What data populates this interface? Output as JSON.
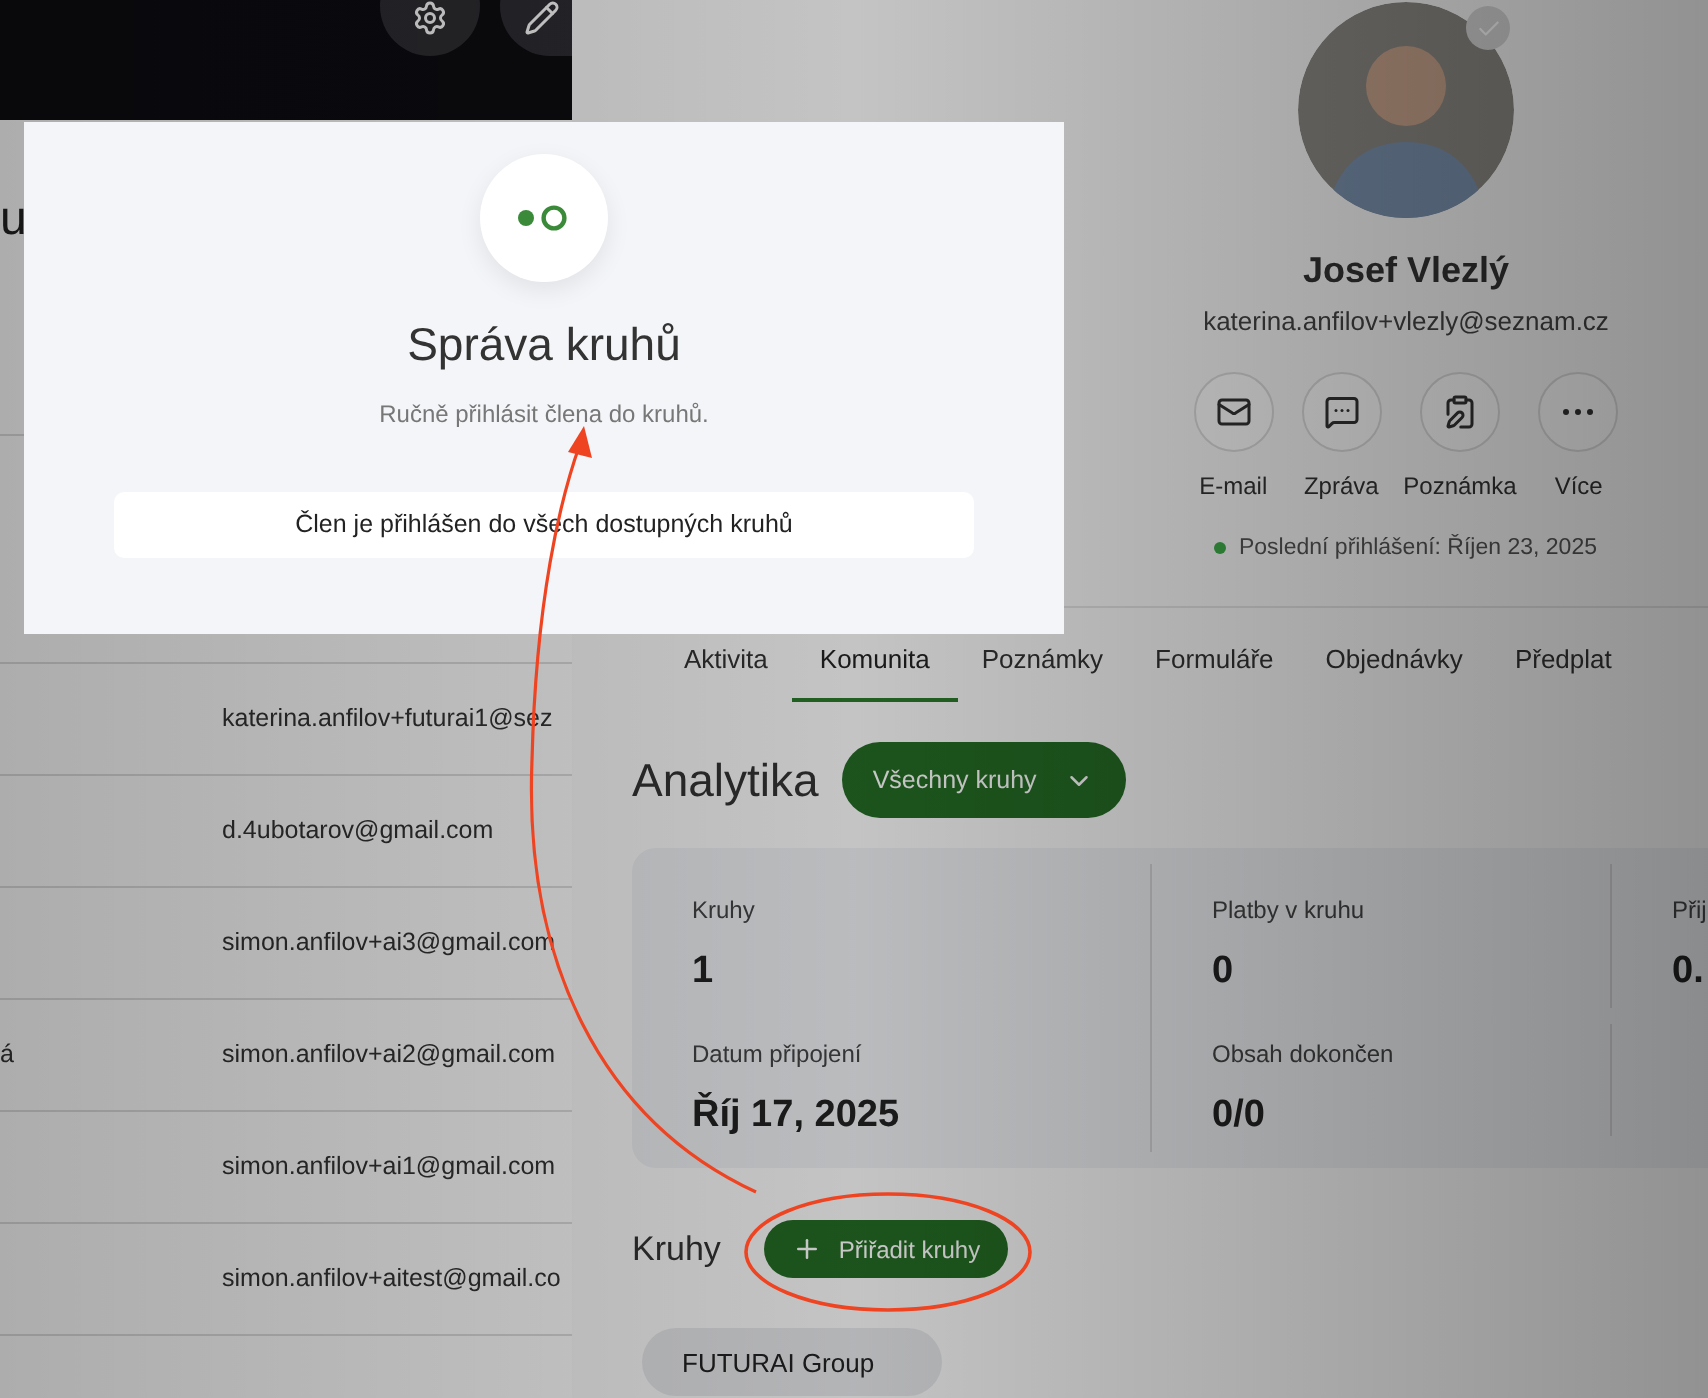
{
  "list_panel": {
    "heading": "u",
    "rows": [
      {
        "email": "katerina.anfilov+futurai1@sez"
      },
      {
        "email": "d.4ubotarov@gmail.com"
      },
      {
        "email": "simon.anfilov+ai3@gmail.com"
      },
      {
        "name": "á",
        "email": "simon.anfilov+ai2@gmail.com"
      },
      {
        "email": "simon.anfilov+ai1@gmail.com"
      },
      {
        "email": "simon.anfilov+aitest@gmail.co"
      }
    ]
  },
  "profile": {
    "name": "Josef Vlezlý",
    "email": "katerina.anfilov+vlezly@seznam.cz",
    "verified": true,
    "actions": [
      {
        "kind": "mail",
        "label": "E-mail"
      },
      {
        "kind": "message",
        "label": "Zpráva"
      },
      {
        "kind": "note",
        "label": "Poznámka"
      },
      {
        "kind": "more",
        "label": "Více"
      }
    ],
    "last_login": {
      "online": true,
      "text": "Poslední přihlášení: Říjen 23, 2025"
    }
  },
  "tabs": [
    {
      "label": "Aktivita",
      "selected": false
    },
    {
      "label": "Komunita",
      "selected": true
    },
    {
      "label": "Poznámky",
      "selected": false
    },
    {
      "label": "Formuláře",
      "selected": false
    },
    {
      "label": "Objednávky",
      "selected": false
    },
    {
      "label": "Předplat",
      "selected": false
    }
  ],
  "analytics": {
    "title": "Analytika",
    "filter": "Všechny kruhy",
    "stats": [
      {
        "label": "Kruhy",
        "value": "1"
      },
      {
        "label": "Platby v kruhu",
        "value": "0"
      },
      {
        "label": "Přij",
        "value": "0."
      },
      {
        "label": "Datum připojení",
        "value": "Říj 17, 2025"
      },
      {
        "label": "Obsah dokončen",
        "value": "0/0"
      }
    ]
  },
  "circles": {
    "title": "Kruhy",
    "add_button": "Přiřadit kruhy",
    "groups": [
      "FUTURAI Group"
    ]
  },
  "modal": {
    "title": "Správa kruhů",
    "subtitle": "Ručně přihlásit člena do kruhů.",
    "message": "Člen je přihlášen do všech dostupných kruhů"
  }
}
